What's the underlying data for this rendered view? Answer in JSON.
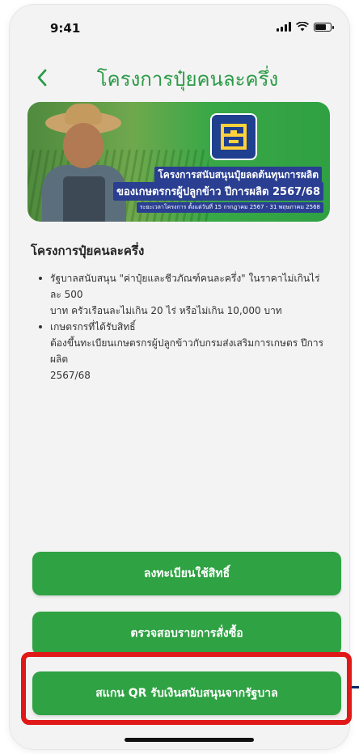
{
  "status_bar": {
    "time": "9:41",
    "battery_level": 0.7,
    "icons": [
      "signal-icon",
      "wifi-icon",
      "battery-icon"
    ]
  },
  "header": {
    "title": "โครงการปุ๋ยคนละครึ่ง",
    "back_icon": "chevron-left-icon"
  },
  "banner": {
    "line1": "โครงการสนับสนุนปุ๋ยลดต้นทุนการผลิต",
    "line2": "ของเกษตรกรผู้ปลูกข้าว ปีการผลิต 2567/68",
    "line3": "ระยะเวลาโครงการ ตั้งแต่วันที่ 15 กรกฎาคม 2567 - 31 พฤษภาคม 2568"
  },
  "content": {
    "section_title": "โครงการปุ๋ยคนละครึ่ง",
    "bullets": [
      {
        "line1": "รัฐบาลสนับสนุน \"ค่าปุ๋ยและชีวภัณฑ์คนละครึ่ง\" ในราคาไม่เกินไร่ละ 500",
        "line2": "บาท ครัวเรือนละไม่เกิน 20 ไร่ หรือไม่เกิน 10,000 บาท"
      },
      {
        "line1": "เกษตรกรที่ได้รับสิทธิ์",
        "line2": "ต้องขึ้นทะเบียนเกษตรกรผู้ปลูกข้าวกับกรมส่งเสริมการเกษตร ปีการผลิต",
        "line3": "2567/68"
      }
    ]
  },
  "buttons": {
    "register": "ลงทะเบียนใช้สิทธิ์",
    "check_orders": "ตรวจสอบรายการสั่งซื้อ",
    "scan_qr": "สแกน QR รับเงินสนับสนุนจากรัฐบาล"
  },
  "colors": {
    "primary_green": "#2fa243",
    "title_green": "#2a9a45",
    "highlight_red": "#e01818"
  }
}
